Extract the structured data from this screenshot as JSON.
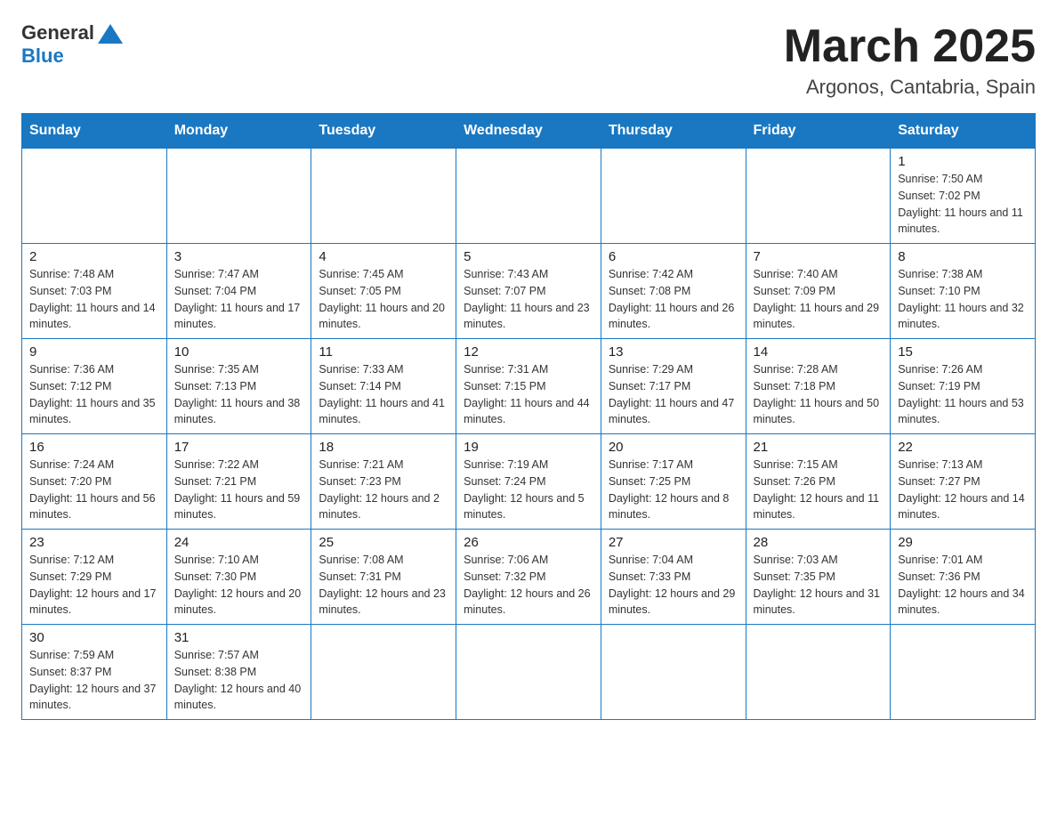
{
  "header": {
    "logo": {
      "general": "General",
      "blue": "Blue"
    },
    "title": "March 2025",
    "location": "Argonos, Cantabria, Spain"
  },
  "weekdays": [
    "Sunday",
    "Monday",
    "Tuesday",
    "Wednesday",
    "Thursday",
    "Friday",
    "Saturday"
  ],
  "weeks": [
    [
      null,
      null,
      null,
      null,
      null,
      null,
      {
        "day": "1",
        "sunrise": "Sunrise: 7:50 AM",
        "sunset": "Sunset: 7:02 PM",
        "daylight": "Daylight: 11 hours and 11 minutes."
      }
    ],
    [
      {
        "day": "2",
        "sunrise": "Sunrise: 7:48 AM",
        "sunset": "Sunset: 7:03 PM",
        "daylight": "Daylight: 11 hours and 14 minutes."
      },
      {
        "day": "3",
        "sunrise": "Sunrise: 7:47 AM",
        "sunset": "Sunset: 7:04 PM",
        "daylight": "Daylight: 11 hours and 17 minutes."
      },
      {
        "day": "4",
        "sunrise": "Sunrise: 7:45 AM",
        "sunset": "Sunset: 7:05 PM",
        "daylight": "Daylight: 11 hours and 20 minutes."
      },
      {
        "day": "5",
        "sunrise": "Sunrise: 7:43 AM",
        "sunset": "Sunset: 7:07 PM",
        "daylight": "Daylight: 11 hours and 23 minutes."
      },
      {
        "day": "6",
        "sunrise": "Sunrise: 7:42 AM",
        "sunset": "Sunset: 7:08 PM",
        "daylight": "Daylight: 11 hours and 26 minutes."
      },
      {
        "day": "7",
        "sunrise": "Sunrise: 7:40 AM",
        "sunset": "Sunset: 7:09 PM",
        "daylight": "Daylight: 11 hours and 29 minutes."
      },
      {
        "day": "8",
        "sunrise": "Sunrise: 7:38 AM",
        "sunset": "Sunset: 7:10 PM",
        "daylight": "Daylight: 11 hours and 32 minutes."
      }
    ],
    [
      {
        "day": "9",
        "sunrise": "Sunrise: 7:36 AM",
        "sunset": "Sunset: 7:12 PM",
        "daylight": "Daylight: 11 hours and 35 minutes."
      },
      {
        "day": "10",
        "sunrise": "Sunrise: 7:35 AM",
        "sunset": "Sunset: 7:13 PM",
        "daylight": "Daylight: 11 hours and 38 minutes."
      },
      {
        "day": "11",
        "sunrise": "Sunrise: 7:33 AM",
        "sunset": "Sunset: 7:14 PM",
        "daylight": "Daylight: 11 hours and 41 minutes."
      },
      {
        "day": "12",
        "sunrise": "Sunrise: 7:31 AM",
        "sunset": "Sunset: 7:15 PM",
        "daylight": "Daylight: 11 hours and 44 minutes."
      },
      {
        "day": "13",
        "sunrise": "Sunrise: 7:29 AM",
        "sunset": "Sunset: 7:17 PM",
        "daylight": "Daylight: 11 hours and 47 minutes."
      },
      {
        "day": "14",
        "sunrise": "Sunrise: 7:28 AM",
        "sunset": "Sunset: 7:18 PM",
        "daylight": "Daylight: 11 hours and 50 minutes."
      },
      {
        "day": "15",
        "sunrise": "Sunrise: 7:26 AM",
        "sunset": "Sunset: 7:19 PM",
        "daylight": "Daylight: 11 hours and 53 minutes."
      }
    ],
    [
      {
        "day": "16",
        "sunrise": "Sunrise: 7:24 AM",
        "sunset": "Sunset: 7:20 PM",
        "daylight": "Daylight: 11 hours and 56 minutes."
      },
      {
        "day": "17",
        "sunrise": "Sunrise: 7:22 AM",
        "sunset": "Sunset: 7:21 PM",
        "daylight": "Daylight: 11 hours and 59 minutes."
      },
      {
        "day": "18",
        "sunrise": "Sunrise: 7:21 AM",
        "sunset": "Sunset: 7:23 PM",
        "daylight": "Daylight: 12 hours and 2 minutes."
      },
      {
        "day": "19",
        "sunrise": "Sunrise: 7:19 AM",
        "sunset": "Sunset: 7:24 PM",
        "daylight": "Daylight: 12 hours and 5 minutes."
      },
      {
        "day": "20",
        "sunrise": "Sunrise: 7:17 AM",
        "sunset": "Sunset: 7:25 PM",
        "daylight": "Daylight: 12 hours and 8 minutes."
      },
      {
        "day": "21",
        "sunrise": "Sunrise: 7:15 AM",
        "sunset": "Sunset: 7:26 PM",
        "daylight": "Daylight: 12 hours and 11 minutes."
      },
      {
        "day": "22",
        "sunrise": "Sunrise: 7:13 AM",
        "sunset": "Sunset: 7:27 PM",
        "daylight": "Daylight: 12 hours and 14 minutes."
      }
    ],
    [
      {
        "day": "23",
        "sunrise": "Sunrise: 7:12 AM",
        "sunset": "Sunset: 7:29 PM",
        "daylight": "Daylight: 12 hours and 17 minutes."
      },
      {
        "day": "24",
        "sunrise": "Sunrise: 7:10 AM",
        "sunset": "Sunset: 7:30 PM",
        "daylight": "Daylight: 12 hours and 20 minutes."
      },
      {
        "day": "25",
        "sunrise": "Sunrise: 7:08 AM",
        "sunset": "Sunset: 7:31 PM",
        "daylight": "Daylight: 12 hours and 23 minutes."
      },
      {
        "day": "26",
        "sunrise": "Sunrise: 7:06 AM",
        "sunset": "Sunset: 7:32 PM",
        "daylight": "Daylight: 12 hours and 26 minutes."
      },
      {
        "day": "27",
        "sunrise": "Sunrise: 7:04 AM",
        "sunset": "Sunset: 7:33 PM",
        "daylight": "Daylight: 12 hours and 29 minutes."
      },
      {
        "day": "28",
        "sunrise": "Sunrise: 7:03 AM",
        "sunset": "Sunset: 7:35 PM",
        "daylight": "Daylight: 12 hours and 31 minutes."
      },
      {
        "day": "29",
        "sunrise": "Sunrise: 7:01 AM",
        "sunset": "Sunset: 7:36 PM",
        "daylight": "Daylight: 12 hours and 34 minutes."
      }
    ],
    [
      {
        "day": "30",
        "sunrise": "Sunrise: 7:59 AM",
        "sunset": "Sunset: 8:37 PM",
        "daylight": "Daylight: 12 hours and 37 minutes."
      },
      {
        "day": "31",
        "sunrise": "Sunrise: 7:57 AM",
        "sunset": "Sunset: 8:38 PM",
        "daylight": "Daylight: 12 hours and 40 minutes."
      },
      null,
      null,
      null,
      null,
      null
    ]
  ]
}
